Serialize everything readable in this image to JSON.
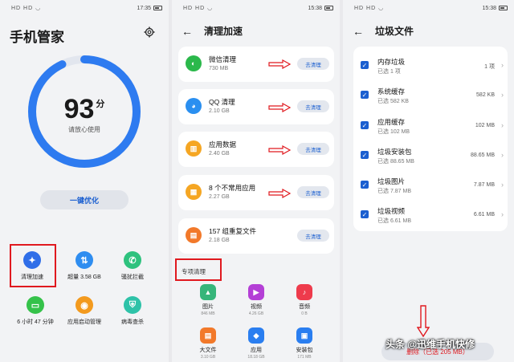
{
  "panel1": {
    "status": {
      "left": "HD HD ◡",
      "time": "17:35"
    },
    "title": "手机管家",
    "score": "93",
    "score_unit": "分",
    "score_level": 0.93,
    "score_sub": "请放心使用",
    "optimize_button": "一键优化",
    "tools": [
      {
        "label": "清理加速",
        "icon": "broom-icon",
        "color": "#2f6ee8"
      },
      {
        "label": "超量 3.58 GB",
        "icon": "data-icon",
        "color": "#2f8df0"
      },
      {
        "label": "骚扰拦截",
        "icon": "phone-block-icon",
        "color": "#2ec27e"
      },
      {
        "label": "6 小时 47 分钟",
        "icon": "battery-icon",
        "color": "#35c24a"
      },
      {
        "label": "应用启动管理",
        "icon": "app-launch-icon",
        "color": "#f39a1e"
      },
      {
        "label": "病毒查杀",
        "icon": "shield-icon",
        "color": "#2ec2a8"
      }
    ]
  },
  "panel2": {
    "status": {
      "left": "HD HD ◡",
      "time": "15:38"
    },
    "title": "清理加速",
    "items": [
      {
        "title": "微信清理",
        "size": "730 MB",
        "button": "去清理",
        "icon": "wechat-icon",
        "color": "#2bb84b"
      },
      {
        "title": "QQ 清理",
        "size": "2.10 GB",
        "button": "去清理",
        "icon": "qq-icon",
        "color": "#2a8ff0"
      },
      {
        "title": "应用数据",
        "size": "2.40 GB",
        "button": "去清理",
        "icon": "app-data-icon",
        "color": "#f5a623"
      },
      {
        "title": "8 个不常用应用",
        "size": "2.27 GB",
        "button": "去清理",
        "icon": "apps-grid-icon",
        "color": "#f5a623"
      },
      {
        "title": "157 组重复文件",
        "size": "2.18 GB",
        "button": "去清理",
        "icon": "duplicate-file-icon",
        "color": "#f2792a"
      }
    ],
    "special_label": "专项清理",
    "categories": [
      {
        "name": "图片",
        "size": "846 MB",
        "icon": "image-icon",
        "color": "#36b57a"
      },
      {
        "name": "视频",
        "size": "4.26 GB",
        "icon": "video-icon",
        "color": "#b43fd6"
      },
      {
        "name": "音频",
        "size": "0 B",
        "icon": "music-icon",
        "color": "#ee3b4c"
      },
      {
        "name": "大文件",
        "size": "3.10 GB",
        "icon": "large-file-icon",
        "color": "#f2792a"
      },
      {
        "name": "应用",
        "size": "18.18 GB",
        "icon": "app-icon",
        "color": "#2a7ef0"
      },
      {
        "name": "安装包",
        "size": "171 MB",
        "icon": "package-icon",
        "color": "#2a7ef0"
      }
    ]
  },
  "panel3": {
    "status": {
      "left": "HD HD ◡",
      "time": "15:38"
    },
    "title": "垃圾文件",
    "rows": [
      {
        "title": "内存垃圾",
        "sub": "已选 1 项",
        "value": "1 项"
      },
      {
        "title": "系统缓存",
        "sub": "已选 582 KB",
        "value": "582 KB"
      },
      {
        "title": "应用缓存",
        "sub": "已选 102 MB",
        "value": "102 MB"
      },
      {
        "title": "垃圾安装包",
        "sub": "已选 88.65 MB",
        "value": "88.65 MB"
      },
      {
        "title": "垃圾图片",
        "sub": "已选 7.87 MB",
        "value": "7.87 MB"
      },
      {
        "title": "垃圾视频",
        "sub": "已选 6.61 MB",
        "value": "6.61 MB"
      }
    ],
    "delete_button": "删除（已选 205 MB）"
  },
  "watermark": "头条 @迅维手机快修"
}
